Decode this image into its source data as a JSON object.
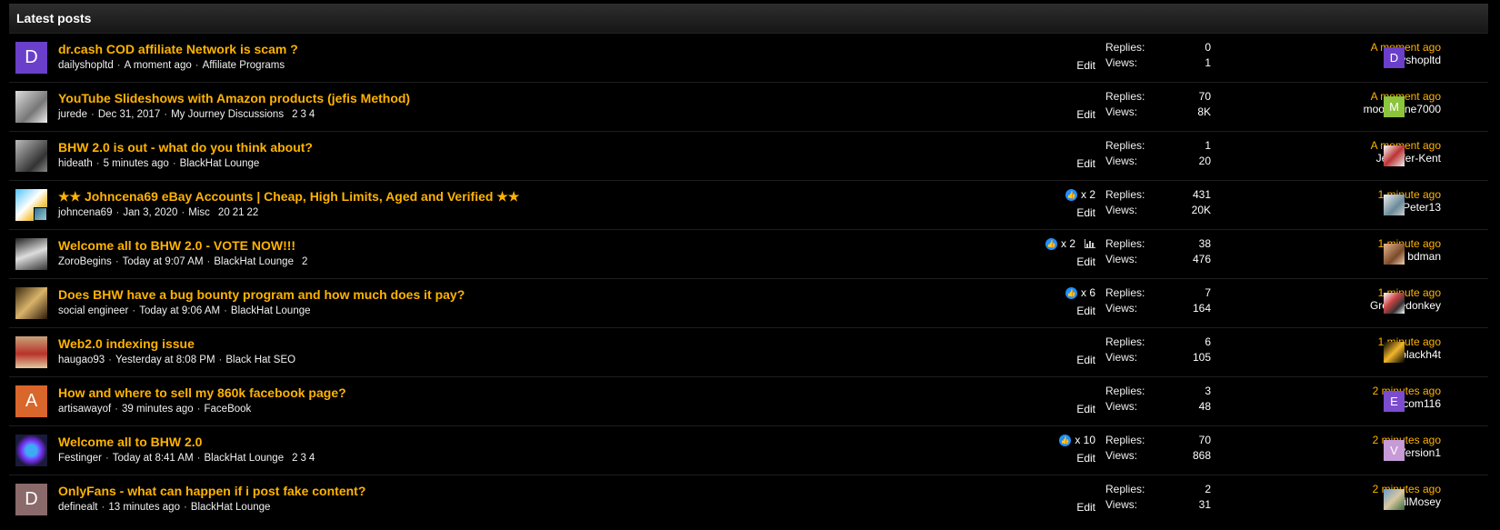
{
  "header": {
    "title": "Latest posts"
  },
  "labels": {
    "replies": "Replies:",
    "views": "Views:",
    "edit": "Edit"
  },
  "icons": {
    "like": "thumbs-up-icon",
    "chart": "bar-chart-icon"
  },
  "colors": {
    "title": "#ffb300",
    "time": "#ffb300",
    "like": "#1e90ff"
  },
  "threads": [
    {
      "title": "dr.cash COD affiliate Network is scam ?",
      "author": "dailyshopltd",
      "date": "A moment ago",
      "forum": "Affiliate Programs",
      "pages": [],
      "likes": "",
      "show_chart": false,
      "avatar": {
        "letter": "D",
        "bg": "#6a3fc9",
        "style": "letter"
      },
      "replies": "0",
      "views": "1",
      "last_time": "A moment ago",
      "last_user": "dailyshopltd",
      "last_avatar": {
        "letter": "D",
        "bg": "#6a3fc9",
        "style": "letter"
      }
    },
    {
      "title": "YouTube Slideshows with Amazon products (jefis Method)",
      "author": "jurede",
      "date": "Dec 31, 2017",
      "forum": "My Journey Discussions",
      "pages": [
        "2",
        "3",
        "4"
      ],
      "likes": "",
      "show_chart": false,
      "avatar": {
        "letter": "",
        "bg": "linear-gradient(135deg,#ddd,#777 60%,#eee)",
        "style": "photo"
      },
      "replies": "70",
      "views": "8K",
      "last_time": "A moment ago",
      "last_user": "moonshine7000",
      "last_avatar": {
        "letter": "M",
        "bg": "#8cc43c",
        "style": "letter"
      }
    },
    {
      "title": "BHW 2.0 is out - what do you think about?",
      "author": "hideath",
      "date": "5 minutes ago",
      "forum": "BlackHat Lounge",
      "pages": [],
      "likes": "",
      "show_chart": false,
      "avatar": {
        "letter": "",
        "bg": "linear-gradient(135deg,#bbb,#333 70%,#888)",
        "style": "photo"
      },
      "replies": "1",
      "views": "20",
      "last_time": "A moment ago",
      "last_user": "Jennifer-Kent",
      "last_avatar": {
        "letter": "",
        "bg": "linear-gradient(135deg,#fff,#b33 50%,#eee)",
        "style": "photo"
      }
    },
    {
      "title": "★★ Johncena69 eBay Accounts | Cheap, High Limits, Aged and Verified ★★",
      "author": "johncena69",
      "date": "Jan 3, 2020",
      "forum": "Misc",
      "pages": [
        "20",
        "21",
        "22"
      ],
      "likes": "x 2",
      "show_chart": false,
      "avatar": {
        "letter": "",
        "bg": "linear-gradient(135deg,#4fc3f7,#fff 45%,#f5c542 70%,#29b6f6)",
        "style": "photo",
        "badge": true
      },
      "replies": "431",
      "views": "20K",
      "last_time": "1 minute ago",
      "last_user": "Peter13",
      "last_avatar": {
        "letter": "",
        "bg": "linear-gradient(135deg,#eee,#6a8a9a 60%,#ccc)",
        "style": "photo"
      }
    },
    {
      "title": "Welcome all to BHW 2.0 - VOTE NOW!!!",
      "author": "ZoroBegins",
      "date": "Today at 9:07 AM",
      "forum": "BlackHat Lounge",
      "pages": [
        "2"
      ],
      "likes": "x 2",
      "show_chart": true,
      "avatar": {
        "letter": "",
        "bg": "linear-gradient(160deg,#222,#ddd 50%,#333)",
        "style": "photo"
      },
      "replies": "38",
      "views": "476",
      "last_time": "1 minute ago",
      "last_user": "bdman",
      "last_avatar": {
        "letter": "",
        "bg": "linear-gradient(135deg,#e8b48a,#7a4a2a 60%,#f0d0b0)",
        "style": "photo"
      }
    },
    {
      "title": "Does BHW have a bug bounty program and how much does it pay?",
      "author": "social engineer",
      "date": "Today at 9:06 AM",
      "forum": "BlackHat Lounge",
      "pages": [],
      "likes": "x 6",
      "show_chart": false,
      "avatar": {
        "letter": "",
        "bg": "linear-gradient(135deg,#3a2a10,#d9b36a 50%,#2a1a08)",
        "style": "photo"
      },
      "replies": "7",
      "views": "164",
      "last_time": "1 minute ago",
      "last_user": "Greasedonkey",
      "last_avatar": {
        "letter": "",
        "bg": "linear-gradient(135deg,#fff,#c44 40%,#333 70%,#fff)",
        "style": "photo"
      }
    },
    {
      "title": "Web2.0 indexing issue",
      "author": "haugao93",
      "date": "Yesterday at 8:08 PM",
      "forum": "Black Hat SEO",
      "pages": [],
      "likes": "",
      "show_chart": false,
      "avatar": {
        "letter": "",
        "bg": "linear-gradient(180deg,#c9a27a,#b8332a 55%,#e2c9a0)",
        "style": "photo"
      },
      "replies": "6",
      "views": "105",
      "last_time": "1 minute ago",
      "last_user": "blackh4t",
      "last_avatar": {
        "letter": "",
        "bg": "linear-gradient(135deg,#000,#f2b62a 50%,#000)",
        "style": "photo"
      }
    },
    {
      "title": "How and where to sell my 860k facebook page?",
      "author": "artisawayof",
      "date": "39 minutes ago",
      "forum": "FaceBook",
      "pages": [],
      "likes": "",
      "show_chart": false,
      "avatar": {
        "letter": "A",
        "bg": "#d9662b",
        "style": "letter"
      },
      "replies": "3",
      "views": "48",
      "last_time": "2 minutes ago",
      "last_user": "ecom116",
      "last_avatar": {
        "letter": "E",
        "bg": "#7b4ccf",
        "style": "letter"
      }
    },
    {
      "title": "Welcome all to BHW 2.0",
      "author": "Festinger",
      "date": "Today at 8:41 AM",
      "forum": "BlackHat Lounge",
      "pages": [
        "2",
        "3",
        "4"
      ],
      "likes": "x 10",
      "show_chart": false,
      "avatar": {
        "letter": "",
        "bg": "radial-gradient(circle,#3fa9f5 25%,#7b2ff7 45%,#1a1a3a 70%)",
        "style": "photo"
      },
      "replies": "70",
      "views": "868",
      "last_time": "2 minutes ago",
      "last_user": "Version1",
      "last_avatar": {
        "letter": "V",
        "bg": "#c79ad8",
        "style": "letter"
      }
    },
    {
      "title": "OnlyFans - what can happen if i post fake content?",
      "author": "definealt",
      "date": "13 minutes ago",
      "forum": "BlackHat Lounge",
      "pages": [],
      "likes": "",
      "show_chart": false,
      "avatar": {
        "letter": "D",
        "bg": "#8a6a6a",
        "style": "letter"
      },
      "replies": "2",
      "views": "31",
      "last_time": "2 minutes ago",
      "last_user": "LilMosey",
      "last_avatar": {
        "letter": "",
        "bg": "linear-gradient(135deg,#6a9acb,#d8c8a0 50%,#3a6a3a)",
        "style": "photo"
      }
    }
  ]
}
